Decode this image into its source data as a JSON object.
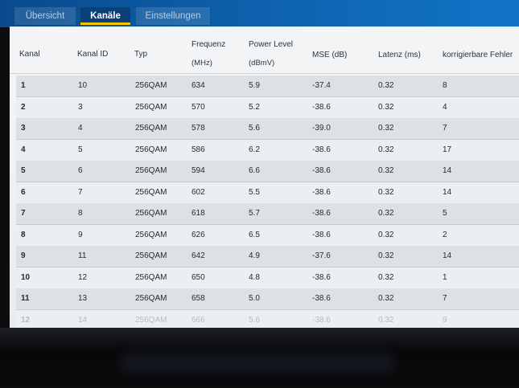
{
  "tabs": [
    {
      "label": "Übersicht",
      "active": false
    },
    {
      "label": "Kanäle",
      "active": true
    },
    {
      "label": "Einstellungen",
      "active": false
    }
  ],
  "table": {
    "headers": {
      "kanal": "Kanal",
      "kanal_id": "Kanal ID",
      "typ": "Typ",
      "frequenz": "Frequenz",
      "frequenz_unit": "(MHz)",
      "power": "Power Level",
      "power_unit": "(dBmV)",
      "mse": "MSE (dB)",
      "latenz": "Latenz (ms)",
      "fehler": "korrigierbare Fehler"
    },
    "rows": [
      {
        "kanal": "1",
        "kanal_id": "10",
        "typ": "256QAM",
        "frequenz": "634",
        "power": "5.9",
        "mse": "-37.4",
        "latenz": "0.32",
        "fehler": "8"
      },
      {
        "kanal": "2",
        "kanal_id": "3",
        "typ": "256QAM",
        "frequenz": "570",
        "power": "5.2",
        "mse": "-38.6",
        "latenz": "0.32",
        "fehler": "4"
      },
      {
        "kanal": "3",
        "kanal_id": "4",
        "typ": "256QAM",
        "frequenz": "578",
        "power": "5.6",
        "mse": "-39.0",
        "latenz": "0.32",
        "fehler": "7"
      },
      {
        "kanal": "4",
        "kanal_id": "5",
        "typ": "256QAM",
        "frequenz": "586",
        "power": "6.2",
        "mse": "-38.6",
        "latenz": "0.32",
        "fehler": "17"
      },
      {
        "kanal": "5",
        "kanal_id": "6",
        "typ": "256QAM",
        "frequenz": "594",
        "power": "6.6",
        "mse": "-38.6",
        "latenz": "0.32",
        "fehler": "14"
      },
      {
        "kanal": "6",
        "kanal_id": "7",
        "typ": "256QAM",
        "frequenz": "602",
        "power": "5.5",
        "mse": "-38.6",
        "latenz": "0.32",
        "fehler": "14"
      },
      {
        "kanal": "7",
        "kanal_id": "8",
        "typ": "256QAM",
        "frequenz": "618",
        "power": "5.7",
        "mse": "-38.6",
        "latenz": "0.32",
        "fehler": "5"
      },
      {
        "kanal": "8",
        "kanal_id": "9",
        "typ": "256QAM",
        "frequenz": "626",
        "power": "6.5",
        "mse": "-38.6",
        "latenz": "0.32",
        "fehler": "2"
      },
      {
        "kanal": "9",
        "kanal_id": "11",
        "typ": "256QAM",
        "frequenz": "642",
        "power": "4.9",
        "mse": "-37.6",
        "latenz": "0.32",
        "fehler": "14"
      },
      {
        "kanal": "10",
        "kanal_id": "12",
        "typ": "256QAM",
        "frequenz": "650",
        "power": "4.8",
        "mse": "-38.6",
        "latenz": "0.32",
        "fehler": "1"
      },
      {
        "kanal": "11",
        "kanal_id": "13",
        "typ": "256QAM",
        "frequenz": "658",
        "power": "5.0",
        "mse": "-38.6",
        "latenz": "0.32",
        "fehler": "7"
      },
      {
        "kanal": "12",
        "kanal_id": "14",
        "typ": "256QAM",
        "frequenz": "666",
        "power": "5.6",
        "mse": "-38.6",
        "latenz": "0.32",
        "fehler": "9"
      }
    ]
  }
}
